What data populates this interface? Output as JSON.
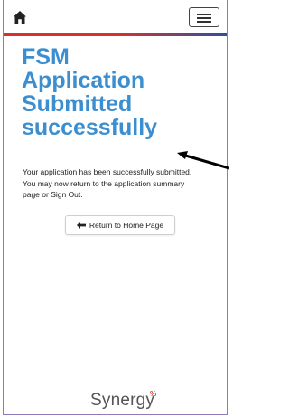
{
  "header": {
    "home_icon": "home-icon",
    "menu_icon": "hamburger-menu-icon"
  },
  "colors": {
    "accent_red": "#d6322d",
    "accent_blue": "#2d4fa0",
    "title_blue": "#3b8fd0"
  },
  "main": {
    "title": "FSM Application Submitted successfully",
    "message": "Your application has been successfully submitted. You may now return to the application summary page or Sign Out.",
    "return_button_label": "Return to Home Page",
    "return_button_icon": "arrow-left-icon"
  },
  "footer": {
    "logo_text": "Synergy",
    "logo_mark": "%"
  }
}
